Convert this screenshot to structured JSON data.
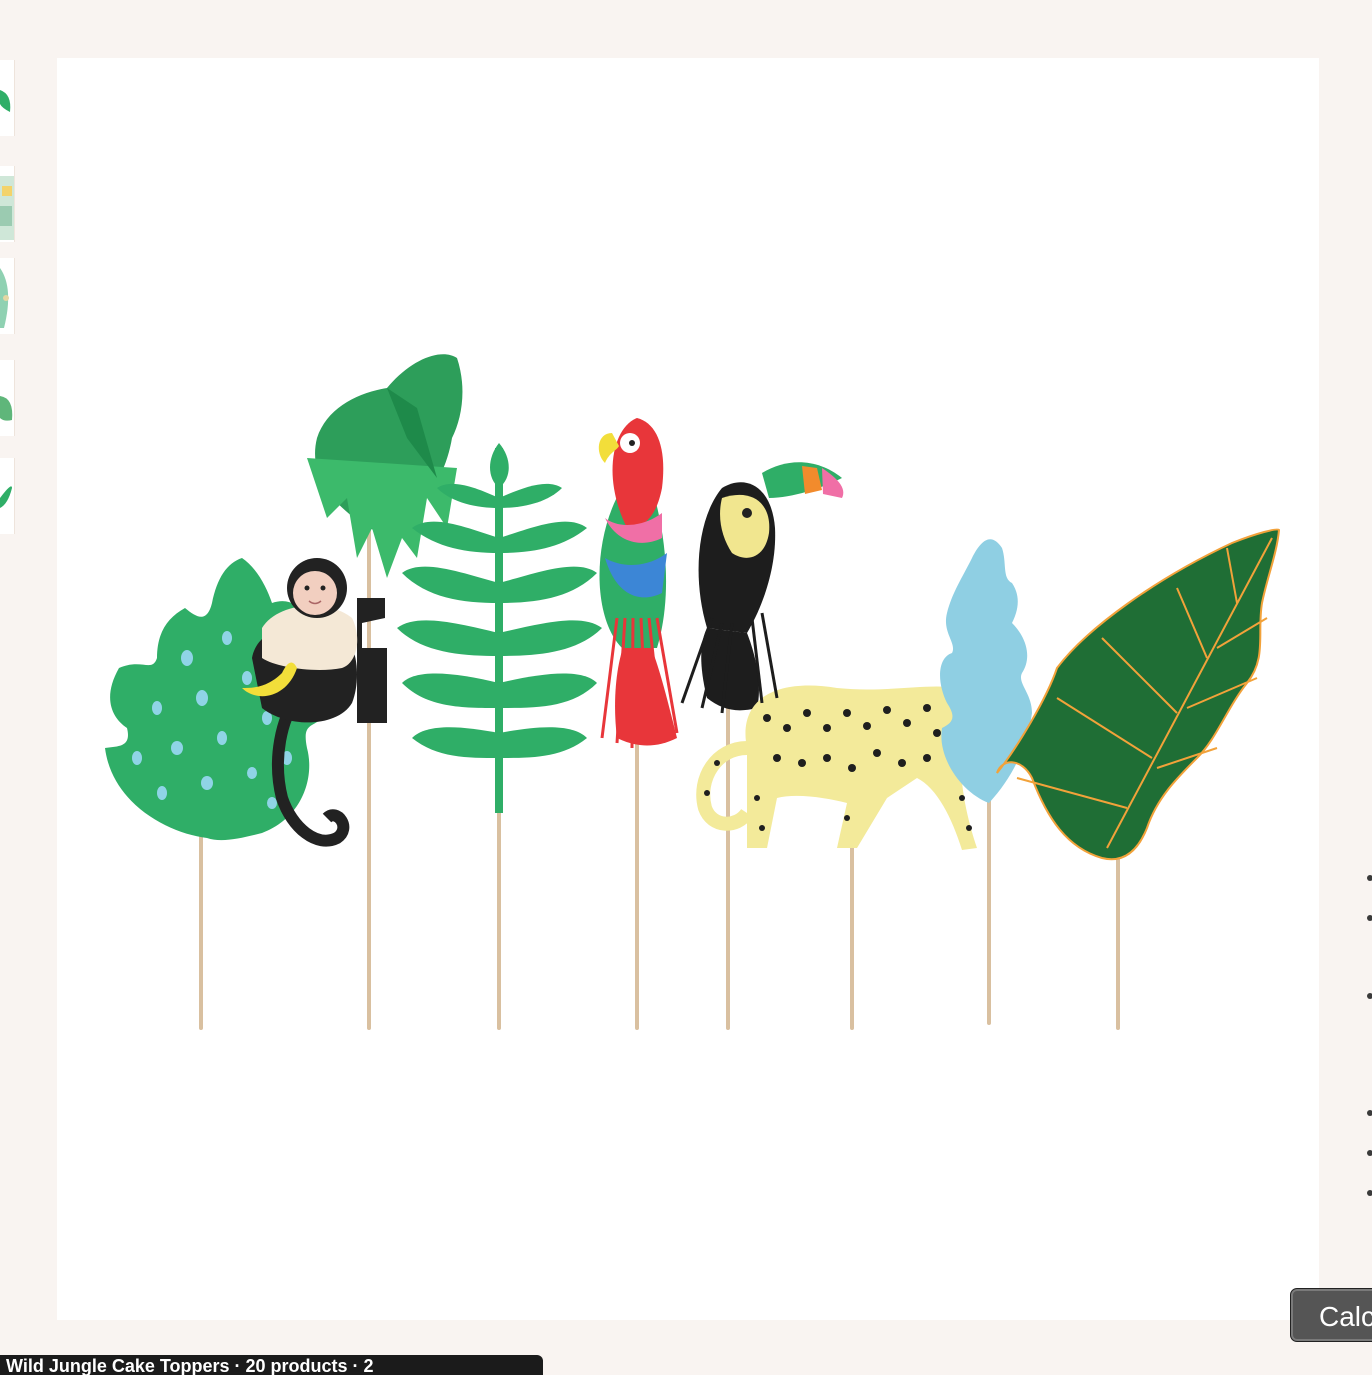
{
  "gallery": {
    "thumbnail_count": 5,
    "main_image": {
      "subject": "jungle-animal-cake-toppers",
      "items": [
        "monstera-leaf",
        "monkey",
        "palm-tree",
        "fern-leaf",
        "parrot",
        "toucan",
        "leopard",
        "blue-leaf",
        "alocasia-leaf"
      ]
    }
  },
  "calc_button": {
    "label": "Calc"
  },
  "bottom_bar": {
    "text": "Wild Jungle Cake Toppers · 20 products · 2"
  },
  "colors": {
    "page_bg": "#f9f4f1",
    "leaf_green": "#2fae67",
    "dark_leaf": "#1f6e35",
    "blue_leaf": "#8fcfe3",
    "parrot_red": "#e8363a",
    "leopard_yellow": "#f3ea9a",
    "stick": "#d9c0a0"
  }
}
